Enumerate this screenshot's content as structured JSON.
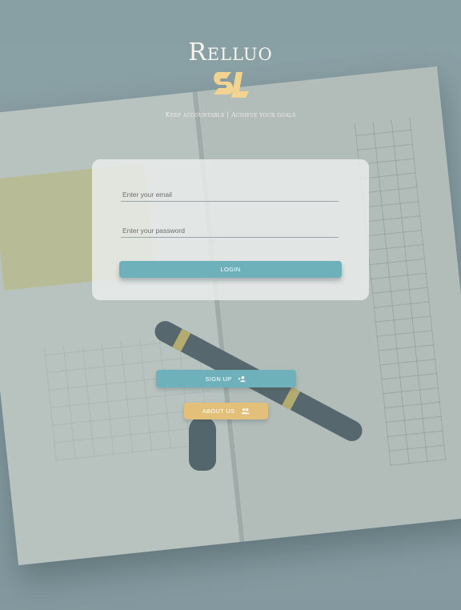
{
  "brand": {
    "name": "Relluo",
    "tagline": "Keep accountable | Achieve your goals"
  },
  "login_form": {
    "email_placeholder": "Enter your email",
    "email_value": "",
    "password_placeholder": "Enter your password",
    "password_value": "",
    "login_label": "LOGIN"
  },
  "actions": {
    "signup_label": "SIGN UP",
    "about_label": "ABOUT US"
  },
  "colors": {
    "primary": "#6fb1bb",
    "accent": "#e3c07a",
    "logo": "#f2d490"
  },
  "icons": {
    "signup": "add-user-icon",
    "about": "group-icon"
  }
}
